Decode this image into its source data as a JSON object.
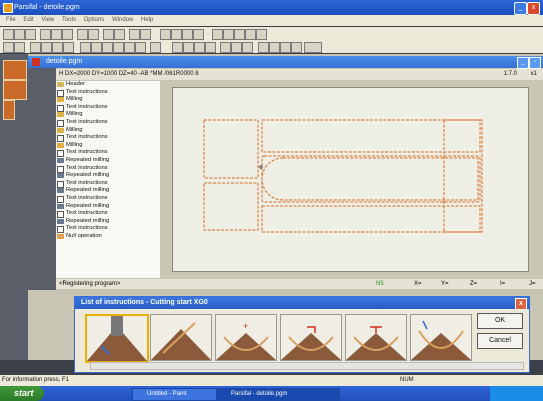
{
  "window": {
    "title": "Parsifal - detoile.pgm"
  },
  "menu": [
    "File",
    "Edit",
    "View",
    "Tools",
    "Options",
    "Window",
    "Help"
  ],
  "child_window": {
    "title": "detoile.pgm"
  },
  "info_line": {
    "text": "H DX=2000 DY=1000 DZ=40 -AB *MM /061R0000 8",
    "scale": "1:7.0",
    "zoom": "x1"
  },
  "tree": {
    "items": [
      {
        "label": "Header",
        "icon": "header-icon"
      },
      {
        "label": "Text instructions",
        "icon": "doc-icon"
      },
      {
        "label": "Milling",
        "icon": "mill-icon"
      },
      {
        "label": "Text instructions",
        "icon": "doc-icon"
      },
      {
        "label": "Milling",
        "icon": "mill-icon"
      },
      {
        "label": "Text instructions",
        "icon": "doc-icon"
      },
      {
        "label": "Milling",
        "icon": "mill-icon"
      },
      {
        "label": "Text instructions",
        "icon": "doc-icon"
      },
      {
        "label": "Milling",
        "icon": "mill-icon"
      },
      {
        "label": "Text instructions",
        "icon": "doc-icon"
      },
      {
        "label": "Repeated milling",
        "icon": "repeat-icon"
      },
      {
        "label": "Text instructions",
        "icon": "doc-icon"
      },
      {
        "label": "Repeated milling",
        "icon": "repeat-icon"
      },
      {
        "label": "Text instructions",
        "icon": "doc-icon"
      },
      {
        "label": "Repeated milling",
        "icon": "repeat-icon"
      },
      {
        "label": "Text instructions",
        "icon": "doc-icon"
      },
      {
        "label": "Repeated milling",
        "icon": "repeat-icon"
      },
      {
        "label": "Text instructions",
        "icon": "doc-icon"
      },
      {
        "label": "Repeated milling",
        "icon": "repeat-icon"
      },
      {
        "label": "Text instructions",
        "icon": "doc-icon"
      },
      {
        "label": "Null operation",
        "icon": "null-icon"
      }
    ]
  },
  "status_row": {
    "registering": "<Registering program>",
    "n": "N5",
    "x": "X=",
    "y": "Y=",
    "z": "Z=",
    "i": "I=",
    "j": "J="
  },
  "dialog": {
    "title": "List of instructions - Cutting start XG0",
    "ok": "OK",
    "cancel": "Cancel"
  },
  "statusbar": {
    "text": "For information press, F1",
    "mode": "NUM"
  },
  "taskbar": {
    "start": "start",
    "tasks": [
      "Untitled - Paint",
      "Parsifal - detoile.pgm"
    ]
  },
  "colors": {
    "cut_line": "#d86a20",
    "titlebar": "#2e66d8",
    "taskbar": "#2250b8",
    "start": "#3f9a3a"
  }
}
